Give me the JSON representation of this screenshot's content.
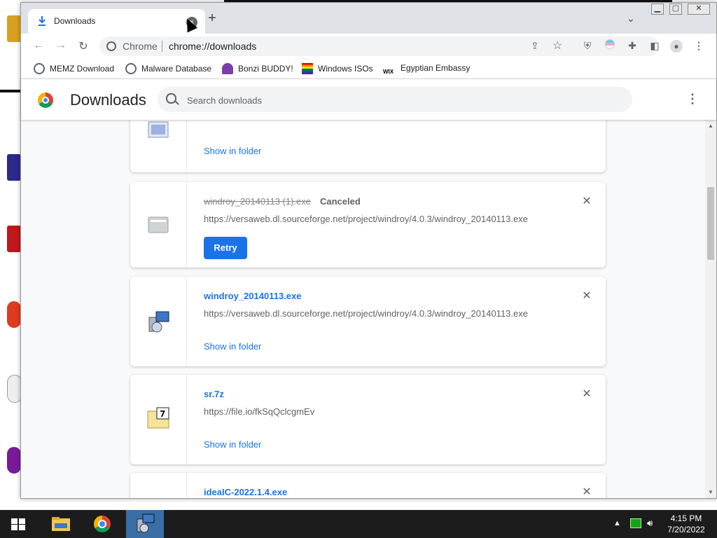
{
  "browser": {
    "tab_title": "Downloads",
    "tab_close_symbol": "×",
    "new_tab_symbol": "+",
    "omnibox_chip": "Chrome",
    "omnibox_url": "chrome://downloads",
    "bookmarks": [
      {
        "label": "MEMZ Download",
        "icon": "globe-icon"
      },
      {
        "label": "Malware Database",
        "icon": "globe-icon"
      },
      {
        "label": "Bonzi BUDDY!",
        "icon": "bonzi-icon"
      },
      {
        "label": "Windows ISOs",
        "icon": "rainbow-flag-icon"
      },
      {
        "label": "Egyptian Embassy",
        "icon": "wix-icon"
      }
    ]
  },
  "downloads_page": {
    "title": "Downloads",
    "search_placeholder": "Search downloads",
    "items": [
      {
        "filename": "",
        "source": "",
        "action": "Show in folder",
        "state": "complete"
      },
      {
        "filename": "windroy_20140113 (1).exe",
        "status": "Canceled",
        "source": "https://versaweb.dl.sourceforge.net/project/windroy/4.0.3/windroy_20140113.exe",
        "action": "Retry",
        "state": "canceled"
      },
      {
        "filename": "windroy_20140113.exe",
        "source": "https://versaweb.dl.sourceforge.net/project/windroy/4.0.3/windroy_20140113.exe",
        "action": "Show in folder",
        "state": "complete"
      },
      {
        "filename": "sr.7z",
        "source": "https://file.io/fkSqQclcgmEv",
        "action": "Show in folder",
        "state": "complete"
      },
      {
        "filename": "ideaIC-2022.1.4.exe",
        "source": "",
        "action": "",
        "state": "complete"
      }
    ]
  },
  "taskbar": {
    "time": "4:15 PM",
    "date": "7/20/2022"
  },
  "colors": {
    "accent": "#1a73e8",
    "taskbar": "#1c1c1c",
    "banner_text": "#e8201c"
  }
}
